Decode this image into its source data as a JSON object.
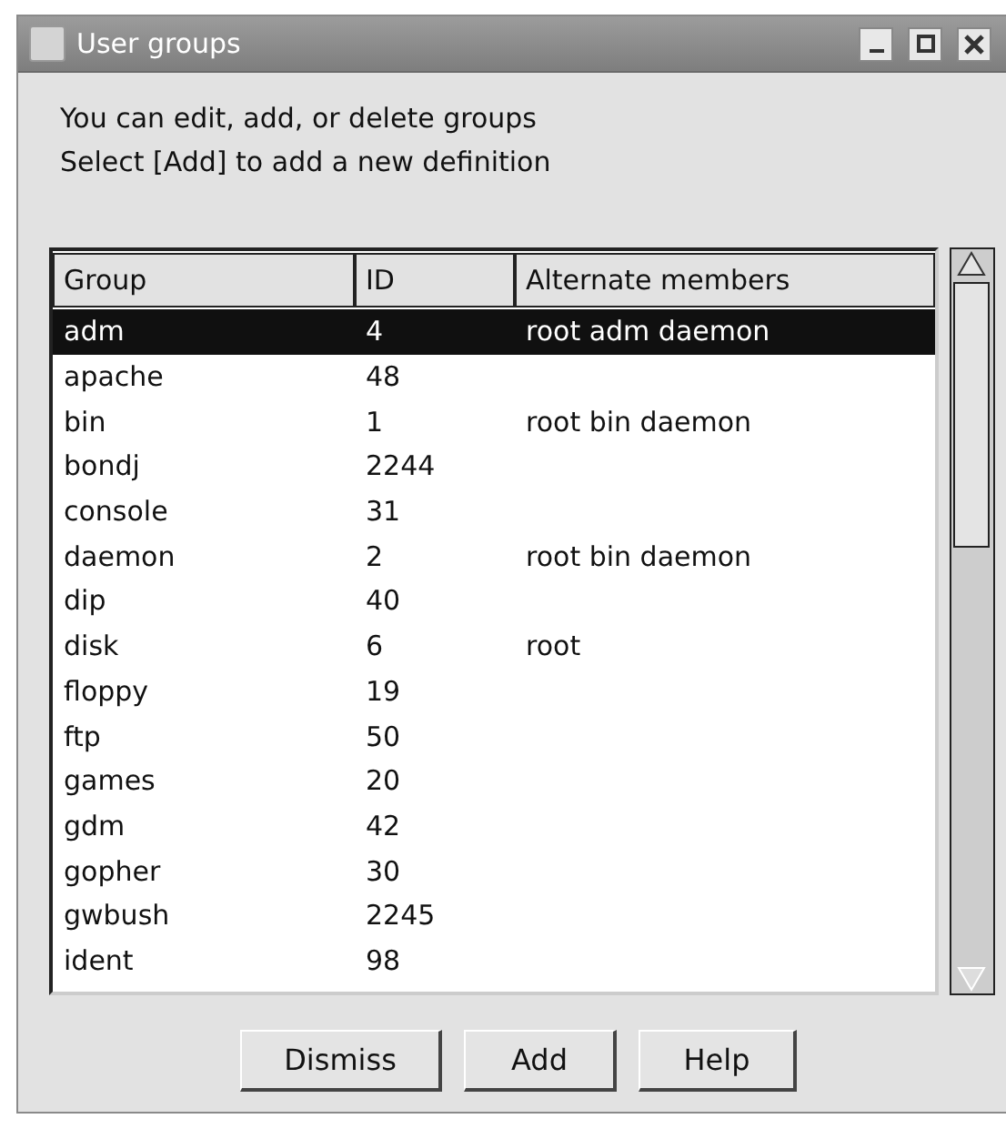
{
  "window": {
    "title": "User groups"
  },
  "message": [
    "You can edit, add, or delete groups",
    "Select [Add] to add a new definition"
  ],
  "table": {
    "columns": [
      "Group",
      "ID",
      "Alternate members"
    ],
    "rows": [
      {
        "cells": [
          "adm",
          "4",
          "root adm daemon"
        ],
        "selected": true
      },
      {
        "cells": [
          "apache",
          "48",
          ""
        ],
        "selected": false
      },
      {
        "cells": [
          "bin",
          "1",
          "root bin daemon"
        ],
        "selected": false
      },
      {
        "cells": [
          "bondj",
          "2244",
          ""
        ],
        "selected": false
      },
      {
        "cells": [
          "console",
          "31",
          ""
        ],
        "selected": false
      },
      {
        "cells": [
          "daemon",
          "2",
          "root bin daemon"
        ],
        "selected": false
      },
      {
        "cells": [
          "dip",
          "40",
          ""
        ],
        "selected": false
      },
      {
        "cells": [
          "disk",
          "6",
          "root"
        ],
        "selected": false
      },
      {
        "cells": [
          "floppy",
          "19",
          ""
        ],
        "selected": false
      },
      {
        "cells": [
          "ftp",
          "50",
          ""
        ],
        "selected": false
      },
      {
        "cells": [
          "games",
          "20",
          ""
        ],
        "selected": false
      },
      {
        "cells": [
          "gdm",
          "42",
          ""
        ],
        "selected": false
      },
      {
        "cells": [
          "gopher",
          "30",
          ""
        ],
        "selected": false
      },
      {
        "cells": [
          "gwbush",
          "2245",
          ""
        ],
        "selected": false
      },
      {
        "cells": [
          "ident",
          "98",
          ""
        ],
        "selected": false
      }
    ]
  },
  "buttons": [
    "Dismiss",
    "Add",
    "Help"
  ]
}
